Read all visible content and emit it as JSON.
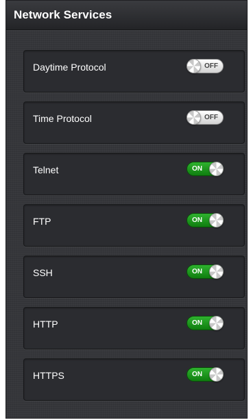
{
  "panel": {
    "title": "Network Services"
  },
  "services": [
    {
      "label": "Daytime Protocol",
      "state": "off",
      "toggle_text": "OFF"
    },
    {
      "label": "Time Protocol",
      "state": "off",
      "toggle_text": "OFF"
    },
    {
      "label": "Telnet",
      "state": "on",
      "toggle_text": "ON"
    },
    {
      "label": "FTP",
      "state": "on",
      "toggle_text": "ON"
    },
    {
      "label": "SSH",
      "state": "on",
      "toggle_text": "ON"
    },
    {
      "label": "HTTP",
      "state": "on",
      "toggle_text": "ON"
    },
    {
      "label": "HTTPS",
      "state": "on",
      "toggle_text": "ON"
    }
  ],
  "colors": {
    "panel_bg": "#35363a",
    "card_bg": "#2b2c30",
    "toggle_on": "#1e9a1e",
    "toggle_off": "#e6e6e6"
  }
}
